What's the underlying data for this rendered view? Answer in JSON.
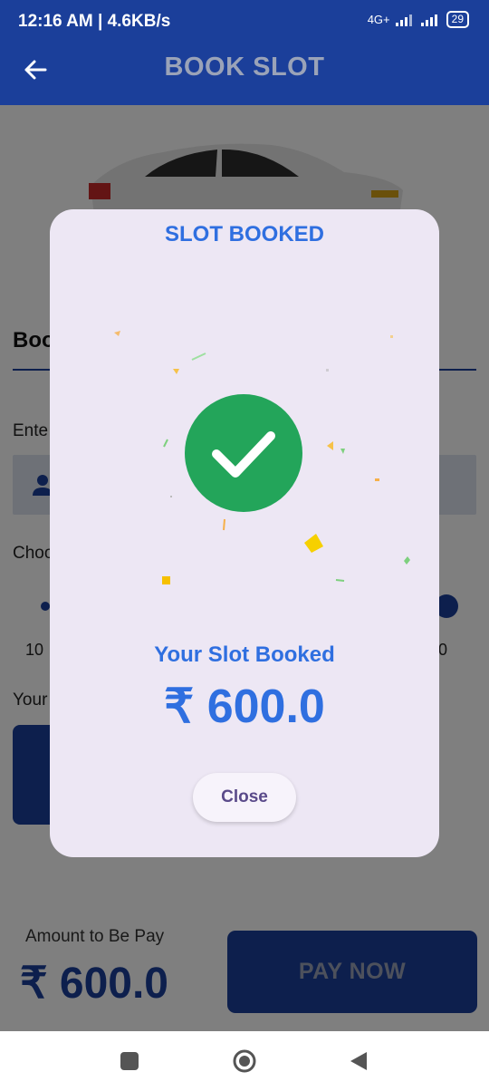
{
  "status_bar": {
    "time": "12:16 AM | 4.6KB/s",
    "network": "4G+",
    "battery": "29"
  },
  "app_bar": {
    "title": "BOOK SLOT",
    "back_icon": "arrow-back-icon"
  },
  "page": {
    "section_heading": "Boo",
    "enter_label": "Ente",
    "choose_label": "Choo",
    "slider_min": "10",
    "slider_max": "0",
    "your_label": "Your"
  },
  "bottom_bar": {
    "amount_label": "Amount to Be Pay",
    "amount_value": "₹ 600.0",
    "pay_button": "PAY NOW"
  },
  "dialog": {
    "title": "SLOT BOOKED",
    "success_icon": "check-circle-icon",
    "message": "Your Slot Booked",
    "amount": "₹ 600.0",
    "close_button": "Close",
    "colors": {
      "accent": "#2f6fe0",
      "success": "#23a55a",
      "background": "#ede7f4"
    }
  },
  "colors": {
    "primary": "#1b3f9a"
  },
  "nav_bar": {
    "recents_icon": "square-icon",
    "home_icon": "home-circle-icon",
    "back_icon": "triangle-back-icon"
  }
}
